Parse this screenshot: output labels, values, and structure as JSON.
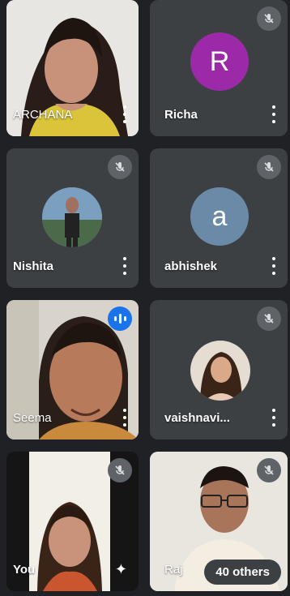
{
  "participants": [
    {
      "name": "ARCHANA",
      "kind": "video"
    },
    {
      "name": "Richa",
      "kind": "letter",
      "letter": "R",
      "avatar_color": "#9c2aa8"
    },
    {
      "name": "Nishita",
      "kind": "photo"
    },
    {
      "name": "abhishek",
      "kind": "letter",
      "letter": "a",
      "avatar_color": "#6b8aa8"
    },
    {
      "name": "Seema",
      "kind": "video"
    },
    {
      "name": "vaishnavi...",
      "kind": "photo"
    },
    {
      "name": "You",
      "kind": "video"
    },
    {
      "name": "Raj",
      "kind": "video"
    }
  ],
  "overflow": {
    "label": "40 others"
  },
  "colors": {
    "tile_bg": "#3c4043",
    "page_bg": "#1f2124",
    "speaking": "#1a73e8",
    "mute_bg": "#5f6368"
  },
  "icons": {
    "mute": "mic-off-icon",
    "menu": "more-vert-icon",
    "speaking": "audio-wave-icon",
    "effects": "sparkle-icon"
  }
}
